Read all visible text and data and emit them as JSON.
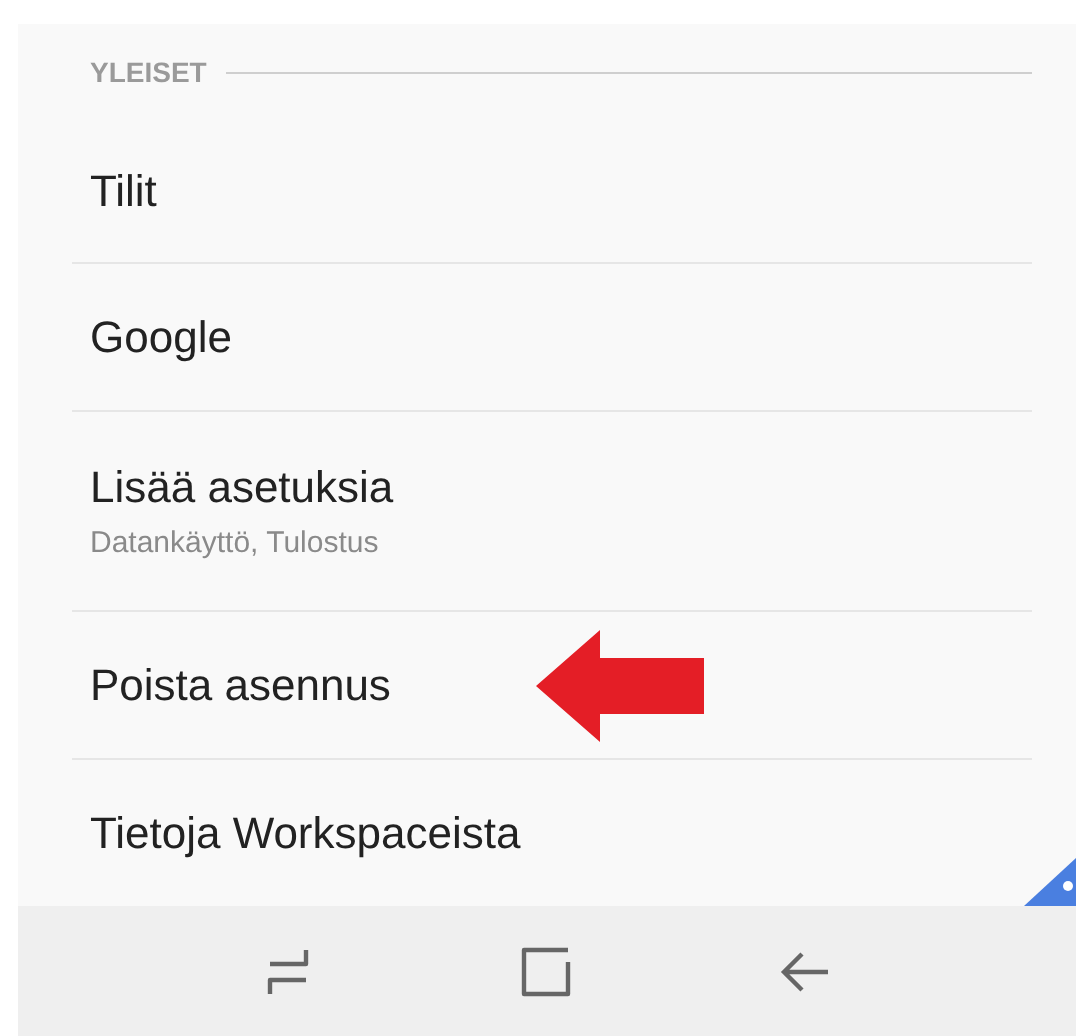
{
  "section": {
    "title": "YLEISET"
  },
  "items": [
    {
      "title": "Tilit"
    },
    {
      "title": "Google"
    },
    {
      "title": "Lisää asetuksia",
      "subtitle": "Datankäyttö, Tulostus"
    },
    {
      "title": "Poista asennus"
    },
    {
      "title": "Tietoja Workspaceista"
    }
  ],
  "nav_buttons": [
    {
      "kind": "recents"
    },
    {
      "kind": "home"
    },
    {
      "kind": "back"
    }
  ]
}
